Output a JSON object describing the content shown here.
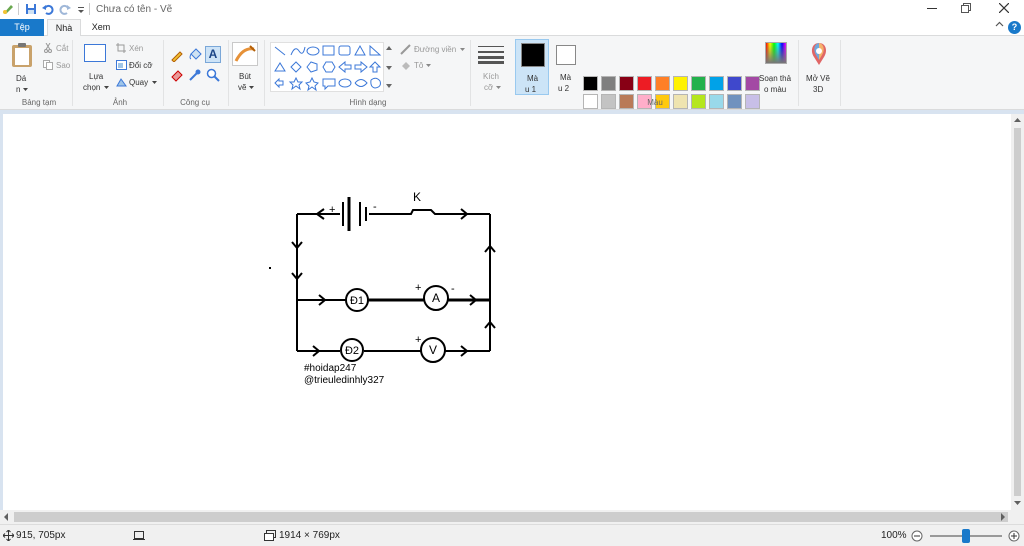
{
  "window": {
    "title": "Chưa có tên - Vẽ"
  },
  "tabs": {
    "file": "Tệp",
    "home": "Nhà",
    "view": "Xem"
  },
  "ribbon": {
    "clipboard": {
      "paste": "Dá",
      "paste_sub": "n",
      "cut": "Cắt",
      "copy": "Sao",
      "label": "Bảng tạm"
    },
    "image": {
      "select": "Lựa",
      "select_sub": "chọn",
      "crop": "Xén",
      "resize": "Đổi cỡ",
      "rotate": "Quay",
      "label": "Ảnh"
    },
    "tools": {
      "label": "Công cụ"
    },
    "brushes": {
      "label_1": "Bút",
      "label_2": "vẽ"
    },
    "shapes": {
      "outline": "Đường viền",
      "fill": "Tô",
      "label": "Hình dạng"
    },
    "size": {
      "label_1": "Kích",
      "label_2": "cỡ"
    },
    "color1": {
      "label_1": "Mà",
      "label_2": "u 1"
    },
    "color2": {
      "label_1": "Mà",
      "label_2": "u 2"
    },
    "edit_colors": {
      "label_1": "Soạn thả",
      "label_2": "o màu"
    },
    "paint3d": {
      "label_1": "Mở Vẽ",
      "label_2": "3D"
    },
    "colors_label": "Màu",
    "palette_row1": [
      "#000000",
      "#7f7f7f",
      "#880015",
      "#ed1c24",
      "#ff7f27",
      "#fff200",
      "#22b14c",
      "#00a2e8",
      "#3f48cc",
      "#a349a4"
    ],
    "palette_row2": [
      "#ffffff",
      "#c3c3c3",
      "#b97a57",
      "#ffaec9",
      "#ffc90e",
      "#efe4b0",
      "#b5e61d",
      "#99d9ea",
      "#7092be",
      "#c8bfe7"
    ],
    "color1_value": "#000000",
    "color2_value": "#ffffff"
  },
  "drawing": {
    "switch_label": "K",
    "plus1": "+",
    "minus1": "-",
    "lamp1": "Đ1",
    "ammeter": "A",
    "plus2": "+",
    "minus2": "-",
    "lamp2": "Đ2",
    "voltmeter": "V",
    "plus3": "+",
    "credit_1": "#hoidap247",
    "credit_2": "@trieuledinhly327"
  },
  "status": {
    "cursor_pos": "915, 705px",
    "canvas_size": "1914 × 769px",
    "zoom": "100%"
  }
}
